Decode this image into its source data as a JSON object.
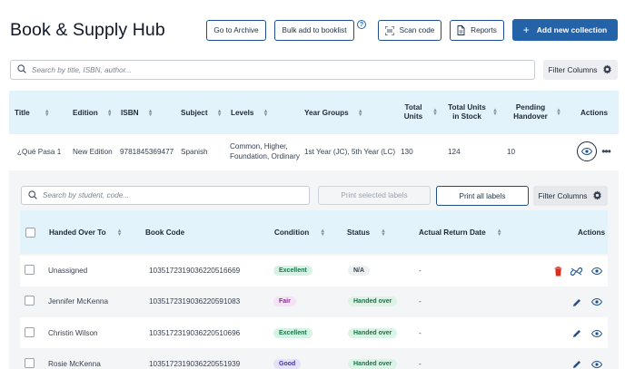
{
  "header": {
    "title": "Book & Supply Hub",
    "go_to_archive": "Go to Archive",
    "bulk_add": "Bulk add to booklist",
    "help": "?",
    "scan_code": "Scan code",
    "reports": "Reports",
    "add_collection": "Add new collection"
  },
  "search": {
    "placeholder": "Search by title, ISBN, author...",
    "filter_columns": "Filter Columns"
  },
  "main_table": {
    "columns": {
      "title": "Title",
      "edition": "Edition",
      "isbn": "ISBN",
      "subject": "Subject",
      "levels": "Levels",
      "year_groups": "Year Groups",
      "total_units": "Total Units",
      "total_units_in_stock": "Total Units in Stock",
      "pending_handover": "Pending Handover",
      "actions": "Actions"
    },
    "row": {
      "title": "¿Qué Pasa 1",
      "edition": "New Edition",
      "isbn": "9781845369477",
      "subject": "Spanish",
      "levels": "Common, Higher, Foundation, Ordinary",
      "year_groups": "1st Year (JC), 5th Year (LC)",
      "total_units": "130",
      "total_units_in_stock": "124",
      "pending_handover": "10"
    }
  },
  "sub": {
    "search_placeholder": "Search by student, code...",
    "print_selected": "Print selected labels",
    "print_all": "Print all labels",
    "filter_columns": "Filter Columns",
    "columns": {
      "handed_over_to": "Handed Over To",
      "book_code": "Book Code",
      "condition": "Condition",
      "status": "Status",
      "actual_return_date": "Actual Return Date",
      "actions": "Actions"
    },
    "rows": [
      {
        "handed_over_to": "Unassigned",
        "book_code": "1035172319036220516669",
        "condition": "Excellent",
        "status": "N/A",
        "return_date": "-"
      },
      {
        "handed_over_to": "Jennifer McKenna",
        "book_code": "1035172319036220591083",
        "condition": "Fair",
        "status": "Handed over",
        "return_date": "-"
      },
      {
        "handed_over_to": "Christin Wilson",
        "book_code": "1035172319036220510696",
        "condition": "Excellent",
        "status": "Handed over",
        "return_date": "-"
      },
      {
        "handed_over_to": "Rosie McKenna",
        "book_code": "1035172319036220551939",
        "condition": "Good",
        "status": "Handed over",
        "return_date": "-"
      }
    ]
  },
  "colors": {
    "primary": "#2563a8",
    "header_bg": "#e3f3fb",
    "delete": "#d92d20"
  }
}
